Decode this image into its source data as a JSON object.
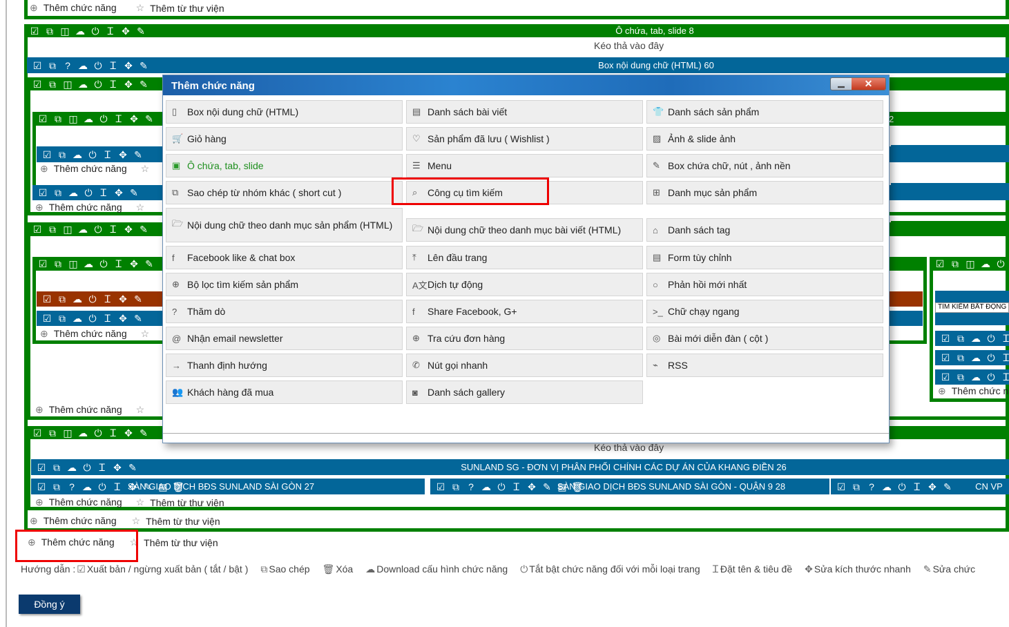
{
  "add_function": "Thêm chức năng",
  "add_from_library": "Thêm từ thư viện",
  "drop_here": "Kéo thả vào đây",
  "colors": {
    "container_green": "#008000",
    "box_blue": "#036699",
    "highlight_orange": "#993300",
    "red_highlight": "#ee0000"
  },
  "bars": {
    "tab_slide_8": "Ô chứa, tab, slide 8",
    "html_box_60": "Box nội dung chữ (HTML) 60",
    "num_2": "2",
    "sunland_26": "SUNLAND SG - ĐƠN VỊ PHÂN PHỐI CHÍNH CÁC DỰ ÁN CỦA KHANG ĐIỀN 26",
    "sunland_27": "SÀN GIAO DỊCH BĐS SUNLAND SÀI GÒN 27",
    "sunland_28": "SÀN GIAO DỊCH BĐS SUNLAND SÀI GÒN - QUẬN 9 28",
    "cn_vp": "CN VP",
    "search_input_value": "TÌM KIẾM BẤT ĐỘNG"
  },
  "modal": {
    "title": "Thêm chức năng",
    "minimize": "▁",
    "close": "✕",
    "columns": [
      [
        {
          "label": "Box nội dung chữ (HTML)",
          "icon": "document-icon"
        },
        {
          "label": "Giỏ hàng",
          "icon": "cart-icon"
        },
        {
          "label": "Ô chứa, tab, slide",
          "icon": "container-icon",
          "highlight": true
        },
        {
          "label": "Sao chép từ nhóm khác ( short cut )",
          "icon": "copy-icon"
        },
        {
          "label": "Nội dung chữ theo danh mục sản phẩm (HTML)",
          "icon": "folder-open-icon"
        },
        {
          "label": "Facebook like & chat box",
          "icon": "facebook-icon"
        },
        {
          "label": "Bộ lọc tìm kiếm sản phẩm",
          "icon": "zoom-in-icon"
        },
        {
          "label": "Thăm dò",
          "icon": "question-icon"
        },
        {
          "label": "Nhận email newsletter",
          "icon": "at-icon"
        },
        {
          "label": "Thanh định hướng",
          "icon": "arrow-right-icon"
        },
        {
          "label": "Khách hàng đã mua",
          "icon": "users-icon"
        }
      ],
      [
        {
          "label": "Danh sách bài viết",
          "icon": "newspaper-icon"
        },
        {
          "label": "Sản phẩm đã lưu ( Wishlist )",
          "icon": "heart-icon"
        },
        {
          "label": "Menu",
          "icon": "list-icon"
        },
        {
          "label": "Công cụ tìm kiếm",
          "icon": "search-icon"
        },
        {
          "label": "Nội dung chữ theo danh mục bài viết (HTML)",
          "icon": "folder-open-icon"
        },
        {
          "label": "Lên đầu trang",
          "icon": "to-top-icon"
        },
        {
          "label": "Dịch tự động",
          "icon": "translate-icon"
        },
        {
          "label": "Share Facebook, G+",
          "icon": "facebook-icon"
        },
        {
          "label": "Tra cứu đơn hàng",
          "icon": "zoom-in-icon"
        },
        {
          "label": "Nút gọi nhanh",
          "icon": "phone-icon"
        },
        {
          "label": "Danh sách gallery",
          "icon": "camera-icon"
        }
      ],
      [
        {
          "label": "Danh sách sản phẩm",
          "icon": "shirt-icon"
        },
        {
          "label": "Ảnh & slide ảnh",
          "icon": "image-icon"
        },
        {
          "label": "Box chứa chữ, nút , ảnh nền",
          "icon": "edit-icon"
        },
        {
          "label": "Danh mục sản phẩm",
          "icon": "sitemap-icon"
        },
        {
          "label": "Danh sách tag",
          "icon": "tag-icon"
        },
        {
          "label": "Form tùy chỉnh",
          "icon": "form-icon"
        },
        {
          "label": "Phản hồi mới nhất",
          "icon": "comment-icon"
        },
        {
          "label": "Chữ chạy ngang",
          "icon": "terminal-icon"
        },
        {
          "label": "Bài mới diễn đàn ( cột )",
          "icon": "comments-icon"
        },
        {
          "label": "RSS",
          "icon": "rss-icon"
        }
      ]
    ]
  },
  "guide": {
    "label": "Hướng dẫn :",
    "items": [
      {
        "icon": "checkbox-icon",
        "label": "Xuất bản / ngừng xuất bản ( tắt / bật )"
      },
      {
        "icon": "copy-icon",
        "label": "Sao chép"
      },
      {
        "icon": "trash-icon",
        "label": "Xóa"
      },
      {
        "icon": "cloud-download-icon",
        "label": "Download cấu hình chức năng"
      },
      {
        "icon": "power-icon",
        "label": "Tắt bật chức năng đối với mỗi loại trang"
      },
      {
        "icon": "text-cursor-icon",
        "label": "Đặt tên & tiêu đề"
      },
      {
        "icon": "move-icon",
        "label": "Sửa kích thước nhanh"
      },
      {
        "icon": "edit-icon",
        "label": "Sửa chức"
      }
    ]
  },
  "submit_button": "Đồng ý"
}
